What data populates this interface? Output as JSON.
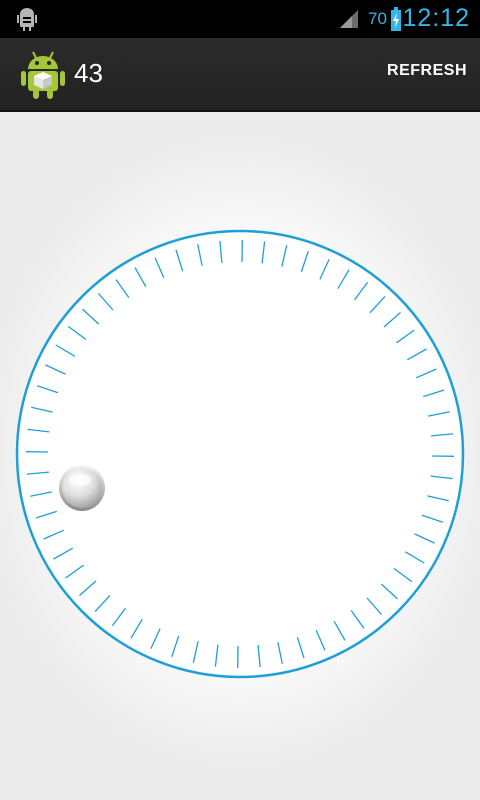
{
  "status_bar": {
    "battery": "70",
    "time": "12:12",
    "accent_color": "#33b5e5"
  },
  "action_bar": {
    "title": "43",
    "refresh_label": "REFRESH",
    "app_icon": "android-cube-icon"
  },
  "dial": {
    "value": 43,
    "tick_count": 60,
    "ring_color": "#1e9fd6",
    "knob": "silver-knob"
  }
}
